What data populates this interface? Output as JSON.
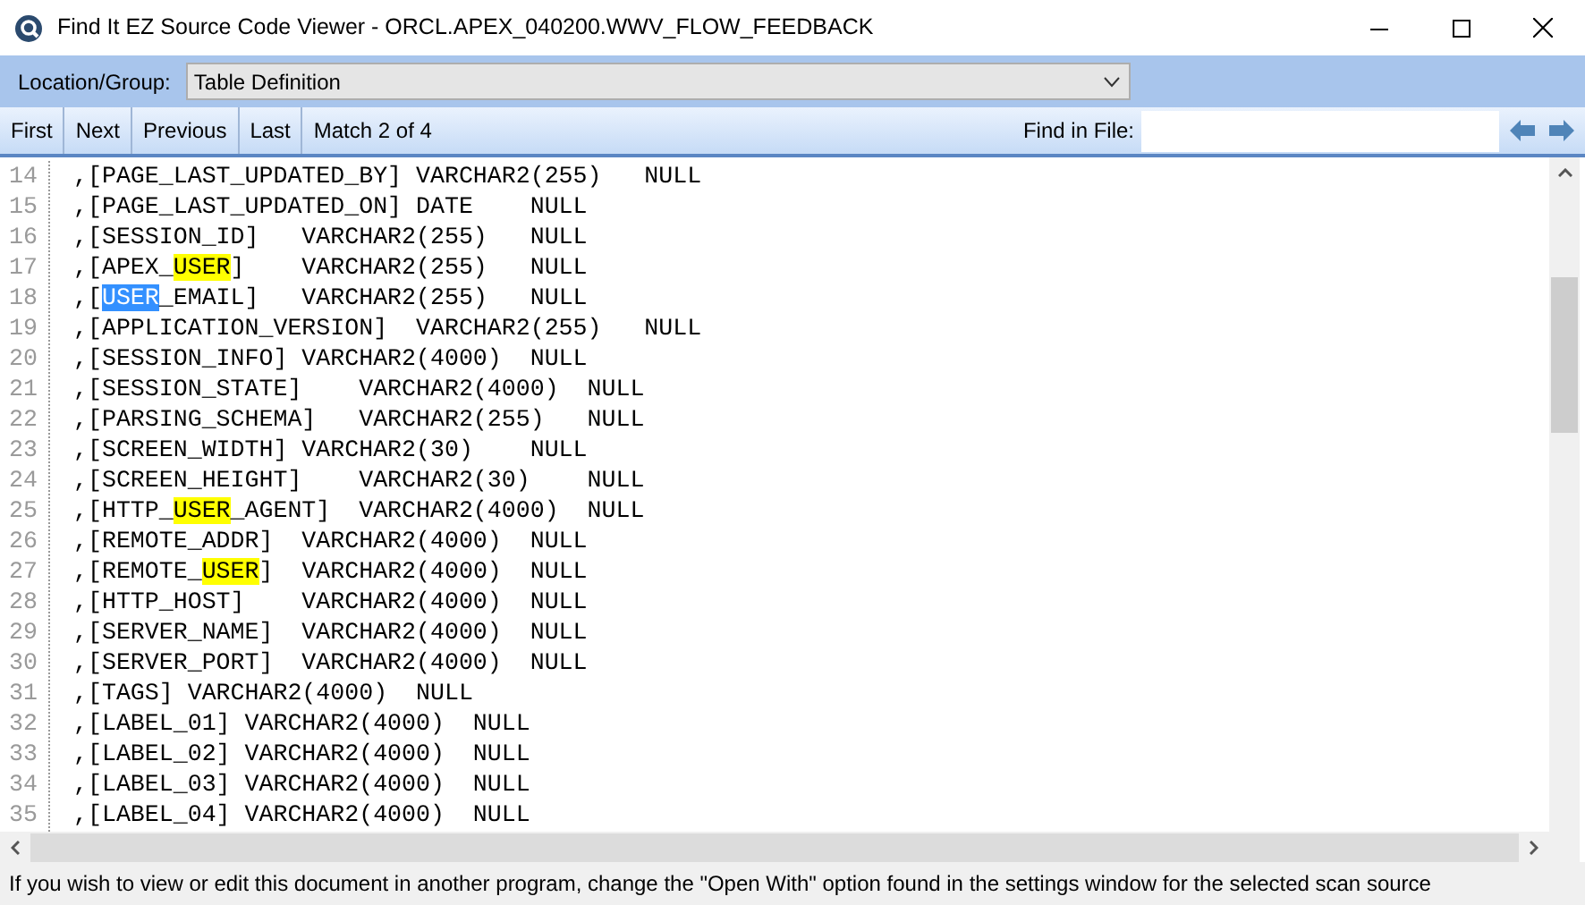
{
  "window": {
    "title": "Find It EZ Source Code Viewer - ORCL.APEX_040200.WWV_FLOW_FEEDBACK"
  },
  "location_bar": {
    "label": "Location/Group:",
    "value": "Table Definition"
  },
  "toolbar": {
    "buttons": [
      "First",
      "Next",
      "Previous",
      "Last"
    ],
    "match_status": "Match 2 of 4",
    "find_label": "Find in File:"
  },
  "code_lines": [
    {
      "number": "14",
      "segments": [
        {
          "text": ",[PAGE_LAST_UPDATED_BY] VARCHAR2(255)   NULL",
          "kind": "plain"
        }
      ]
    },
    {
      "number": "15",
      "segments": [
        {
          "text": ",[PAGE_LAST_UPDATED_ON] DATE    NULL",
          "kind": "plain"
        }
      ]
    },
    {
      "number": "16",
      "segments": [
        {
          "text": ",[SESSION_ID]   VARCHAR2(255)   NULL",
          "kind": "plain"
        }
      ]
    },
    {
      "number": "17",
      "segments": [
        {
          "text": ",[APEX_",
          "kind": "plain"
        },
        {
          "text": "USER",
          "kind": "match"
        },
        {
          "text": "]    VARCHAR2(255)   NULL",
          "kind": "plain"
        }
      ]
    },
    {
      "number": "18",
      "segments": [
        {
          "text": ",[",
          "kind": "plain"
        },
        {
          "text": "USER",
          "kind": "current"
        },
        {
          "text": "_EMAIL]   VARCHAR2(255)   NULL",
          "kind": "plain"
        }
      ]
    },
    {
      "number": "19",
      "segments": [
        {
          "text": ",[APPLICATION_VERSION]  VARCHAR2(255)   NULL",
          "kind": "plain"
        }
      ]
    },
    {
      "number": "20",
      "segments": [
        {
          "text": ",[SESSION_INFO] VARCHAR2(4000)  NULL",
          "kind": "plain"
        }
      ]
    },
    {
      "number": "21",
      "segments": [
        {
          "text": ",[SESSION_STATE]    VARCHAR2(4000)  NULL",
          "kind": "plain"
        }
      ]
    },
    {
      "number": "22",
      "segments": [
        {
          "text": ",[PARSING_SCHEMA]   VARCHAR2(255)   NULL",
          "kind": "plain"
        }
      ]
    },
    {
      "number": "23",
      "segments": [
        {
          "text": ",[SCREEN_WIDTH] VARCHAR2(30)    NULL",
          "kind": "plain"
        }
      ]
    },
    {
      "number": "24",
      "segments": [
        {
          "text": ",[SCREEN_HEIGHT]    VARCHAR2(30)    NULL",
          "kind": "plain"
        }
      ]
    },
    {
      "number": "25",
      "segments": [
        {
          "text": ",[HTTP_",
          "kind": "plain"
        },
        {
          "text": "USER",
          "kind": "match"
        },
        {
          "text": "_AGENT]  VARCHAR2(4000)  NULL",
          "kind": "plain"
        }
      ]
    },
    {
      "number": "26",
      "segments": [
        {
          "text": ",[REMOTE_ADDR]  VARCHAR2(4000)  NULL",
          "kind": "plain"
        }
      ]
    },
    {
      "number": "27",
      "segments": [
        {
          "text": ",[REMOTE_",
          "kind": "plain"
        },
        {
          "text": "USER",
          "kind": "match"
        },
        {
          "text": "]  VARCHAR2(4000)  NULL",
          "kind": "plain"
        }
      ]
    },
    {
      "number": "28",
      "segments": [
        {
          "text": ",[HTTP_HOST]    VARCHAR2(4000)  NULL",
          "kind": "plain"
        }
      ]
    },
    {
      "number": "29",
      "segments": [
        {
          "text": ",[SERVER_NAME]  VARCHAR2(4000)  NULL",
          "kind": "plain"
        }
      ]
    },
    {
      "number": "30",
      "segments": [
        {
          "text": ",[SERVER_PORT]  VARCHAR2(4000)  NULL",
          "kind": "plain"
        }
      ]
    },
    {
      "number": "31",
      "segments": [
        {
          "text": ",[TAGS] VARCHAR2(4000)  NULL",
          "kind": "plain"
        }
      ]
    },
    {
      "number": "32",
      "segments": [
        {
          "text": ",[LABEL_01] VARCHAR2(4000)  NULL",
          "kind": "plain"
        }
      ]
    },
    {
      "number": "33",
      "segments": [
        {
          "text": ",[LABEL_02] VARCHAR2(4000)  NULL",
          "kind": "plain"
        }
      ]
    },
    {
      "number": "34",
      "segments": [
        {
          "text": ",[LABEL_03] VARCHAR2(4000)  NULL",
          "kind": "plain"
        }
      ]
    },
    {
      "number": "35",
      "segments": [
        {
          "text": ",[LABEL_04] VARCHAR2(4000)  NULL",
          "kind": "plain"
        }
      ]
    }
  ],
  "status_bar": "If you wish to view or edit this document in another program, change the \"Open With\" option found in the settings window for the selected scan source"
}
